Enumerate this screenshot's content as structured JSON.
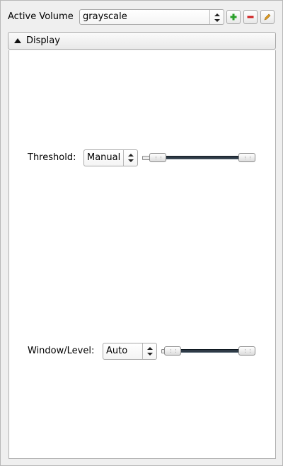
{
  "header": {
    "active_volume_label": "Active Volume",
    "volume_select_value": "grayscale",
    "buttons": [
      {
        "name": "add",
        "icon": "plus-icon",
        "color": "#2aa02a"
      },
      {
        "name": "remove",
        "icon": "minus-icon",
        "color": "#d02020"
      },
      {
        "name": "edit",
        "icon": "pencil-icon",
        "color": "#d08a10"
      }
    ]
  },
  "display": {
    "section_label": "Display",
    "expanded": true,
    "threshold": {
      "label": "Threshold:",
      "mode_value": "Manual",
      "range_low_fraction": 0.0,
      "range_high_fraction": 1.0
    },
    "window_level": {
      "label": "Window/Level:",
      "mode_value": "Auto",
      "range_low_fraction": 0.0,
      "range_high_fraction": 1.0
    }
  },
  "colors": {
    "track": "#2e3a46",
    "panel_bg": "#ffffff",
    "window_bg": "#efefef"
  }
}
